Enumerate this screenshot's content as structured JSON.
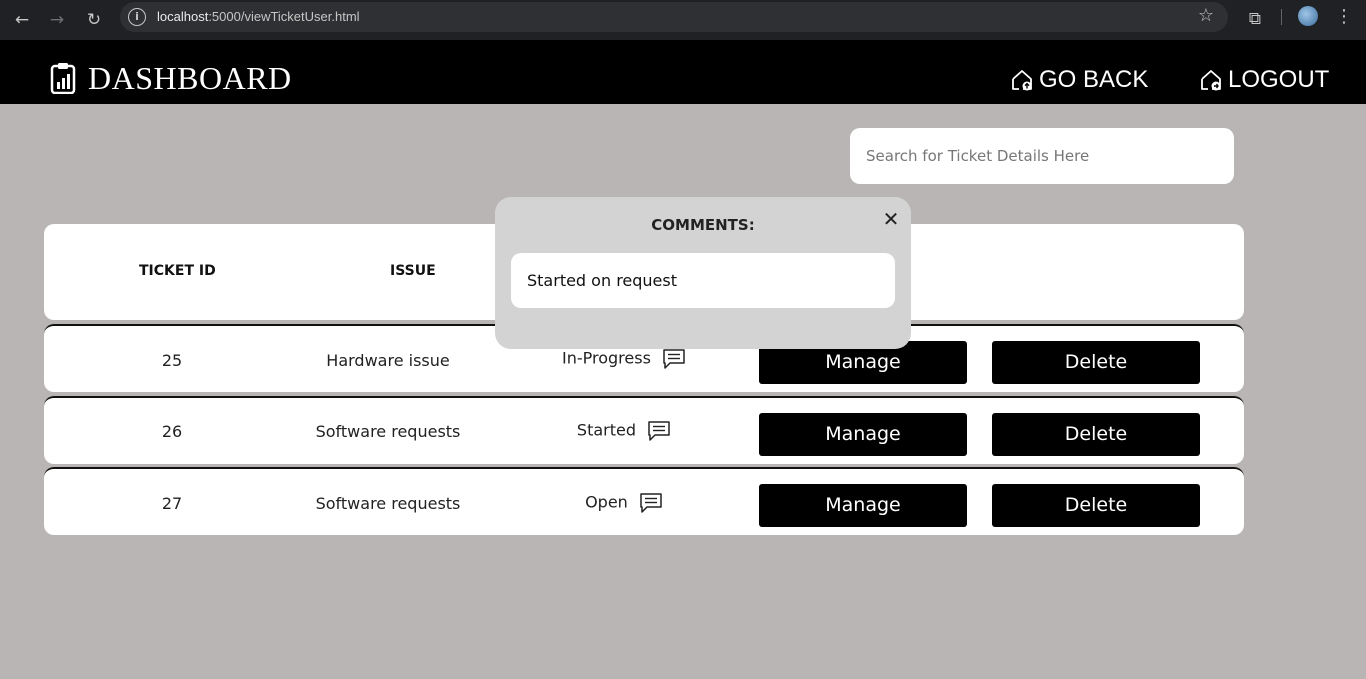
{
  "browser": {
    "url_host": "localhost",
    "url_path": ":5000/viewTicketUser.html"
  },
  "header": {
    "title": "DASHBOARD",
    "go_back_label": "GO BACK",
    "logout_label": "LOGOUT"
  },
  "search": {
    "placeholder": "Search for Ticket Details Here",
    "value": ""
  },
  "table": {
    "columns": [
      "TICKET ID",
      "ISSUE"
    ],
    "rows": [
      {
        "id": "25",
        "issue": "Hardware issue",
        "status": "In-Progress",
        "manage": "Manage",
        "delete": "Delete"
      },
      {
        "id": "26",
        "issue": "Software requests",
        "status": "Started",
        "manage": "Manage",
        "delete": "Delete"
      },
      {
        "id": "27",
        "issue": "Software requests",
        "status": "Open",
        "manage": "Manage",
        "delete": "Delete"
      }
    ]
  },
  "modal": {
    "title": "COMMENTS:",
    "comment": "Started on request",
    "close_icon": "close-icon"
  },
  "colors": {
    "page_bg": "#bab5b5",
    "header_bg": "#000000",
    "button_bg": "#000000",
    "modal_bg": "#d3d3d3"
  }
}
